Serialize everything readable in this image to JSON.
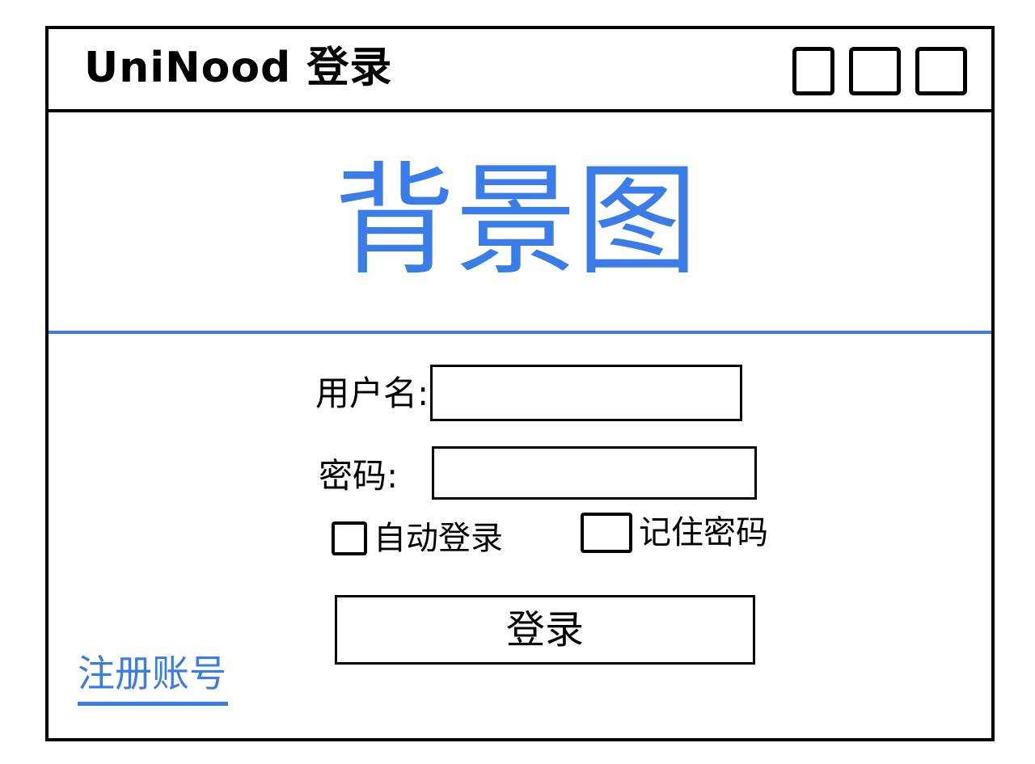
{
  "window": {
    "title": "UniNood 登录"
  },
  "banner": {
    "text": "背景图"
  },
  "form": {
    "username_label": "用户名:",
    "username_value": "",
    "password_label": "密码:",
    "password_value": "",
    "auto_login_label": "自动登录",
    "auto_login_checked": false,
    "remember_password_label": "记住密码",
    "remember_password_checked": false,
    "login_button_label": "登录"
  },
  "register_link": {
    "label": "注册账号"
  },
  "colors": {
    "accent": "#3a7de8",
    "border": "#000000",
    "background": "#ffffff"
  },
  "icons": {
    "window_controls": [
      "minimize-icon",
      "maximize-icon",
      "close-icon"
    ]
  }
}
